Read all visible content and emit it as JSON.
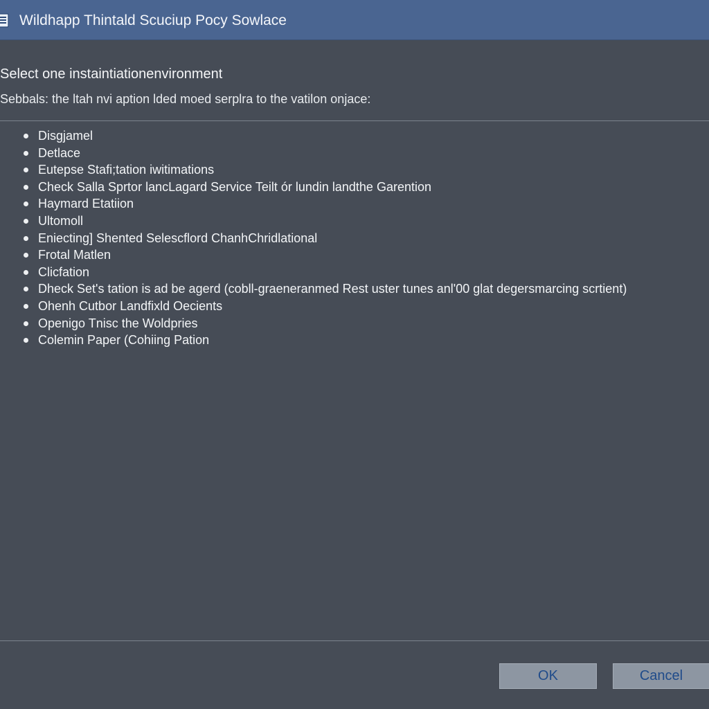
{
  "window": {
    "title": "Wildhapp Thintald Scuciup Pocy Sowlace",
    "app_icon": "document-list-icon"
  },
  "dialog": {
    "heading": "Select one instaintiationenvironment",
    "subheading": "Sebbals: the ltah nvi aption lded moed serplra to the vatilon onjace:",
    "options": [
      {
        "label": "Disgjamel"
      },
      {
        "label": "Detlace"
      },
      {
        "label": "Eutepse Stafi;tation iwitimations"
      },
      {
        "label": "Check Salla Sprtor lancLagard Service Teilt ór lundin landthe Garention"
      },
      {
        "label": "Haymard Etatiion"
      },
      {
        "label": "Ultomoll"
      },
      {
        "label": "Eniecting] Shented Selescflord ChanhChridlational"
      },
      {
        "label": "Frotal Matlen"
      },
      {
        "label": "Clicfation"
      },
      {
        "label": "Dheck Set's tation is ad be agerd (cobll-graeneranmed Rest uster tunes anl'00 glat degersmarcing scrtient)"
      },
      {
        "label": "Ohenh Cutbor Landfixld Oecients"
      },
      {
        "label": "Openigo Tnisc the Woldpries"
      },
      {
        "label": "Colemin Paper (Cohiing Pation"
      }
    ]
  },
  "buttons": {
    "ok_label": "OK",
    "cancel_label": "Cancel"
  },
  "colors": {
    "titlebar": "#4a6591",
    "background": "#464c56",
    "button_face": "#8d96a2",
    "button_text": "#1f4b8a"
  }
}
